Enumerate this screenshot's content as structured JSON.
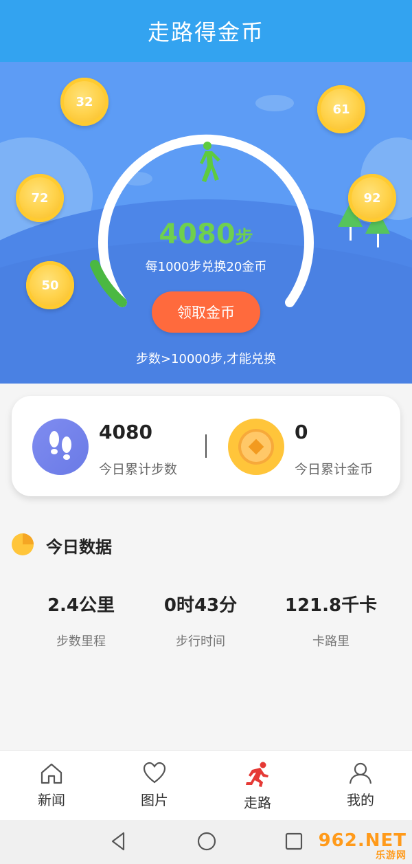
{
  "header": {
    "title": "走路得金币"
  },
  "hero": {
    "coins": [
      "32",
      "61",
      "72",
      "92",
      "50"
    ],
    "steps_value": "4080",
    "steps_unit": "步",
    "rate_text": "每1000步兑换20金币",
    "claim_label": "领取金币",
    "hint_text": "步数>10000步,才能兑换",
    "progress_fraction": 0.408
  },
  "summary": {
    "steps_value": "4080",
    "steps_label": "今日累计步数",
    "coins_value": "0",
    "coins_label": "今日累计金币"
  },
  "today": {
    "title": "今日数据",
    "metrics": [
      {
        "value": "2.4公里",
        "label": "步数里程"
      },
      {
        "value": "0时43分",
        "label": "步行时间"
      },
      {
        "value": "121.8千卡",
        "label": "卡路里"
      }
    ]
  },
  "tabs": [
    {
      "label": "新闻",
      "icon": "home-icon"
    },
    {
      "label": "图片",
      "icon": "heart-icon"
    },
    {
      "label": "走路",
      "icon": "running-icon"
    },
    {
      "label": "我的",
      "icon": "user-icon"
    }
  ],
  "active_tab": "走路",
  "watermark": {
    "main": "962.NET",
    "sub": "乐游网"
  },
  "colors": {
    "header": "#33a3f0",
    "hero": "#5d9cf5",
    "accent_green": "#6fd04e",
    "button": "#ff6a3d",
    "coin": "#ffc53a",
    "active_tab": "#e53935"
  }
}
